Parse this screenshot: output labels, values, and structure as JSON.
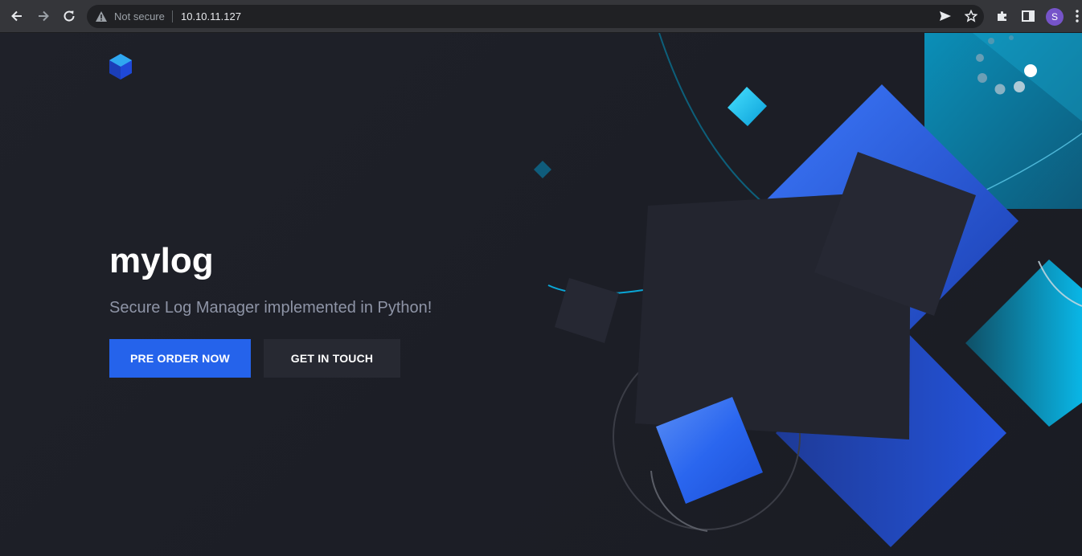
{
  "browser": {
    "security_label": "Not secure",
    "url": "10.10.11.127",
    "profile_initial": "S",
    "icons": [
      "back-arrow-icon",
      "forward-arrow-icon",
      "reload-icon",
      "warning-icon",
      "send-icon",
      "star-icon",
      "extensions-icon",
      "sidepanel-icon",
      "more-icon"
    ]
  },
  "hero": {
    "title": "mylog",
    "subtitle": "Secure Log Manager implemented in Python!",
    "primary_button": "PRE ORDER NOW",
    "secondary_button": "GET IN TOUCH"
  },
  "colors": {
    "background": "#1e2028",
    "accent_blue": "#2563eb",
    "cyan": "#0aa6d6",
    "dark_square": "#23252f"
  }
}
